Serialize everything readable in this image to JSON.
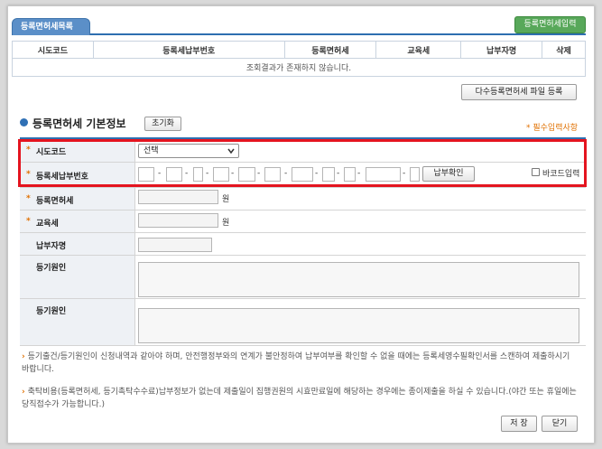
{
  "list_tab": {
    "label": "등록면허세목록"
  },
  "list_add_button": "등록면허세입력",
  "list_table": {
    "headers": [
      "시도코드",
      "등록세납부번호",
      "등록면허세",
      "교육세",
      "납부자명",
      "삭제"
    ],
    "empty_message": "조회결과가 존재하지 않습니다."
  },
  "bulk_register_button": "다수등록면허세 파일 등록",
  "basic_info": {
    "title": "등록면허세 기본정보",
    "reset_button": "초기화",
    "required_note": "* 필수입력사항"
  },
  "form": {
    "sido_label": "시도코드",
    "sido_selected": "선택",
    "payment_no_label": "등록세납부번호",
    "confirm_button": "납부확인",
    "barcode_label": "바코드입력",
    "reg_tax_label": "등록면허세",
    "edu_tax_label": "교육세",
    "payer_label": "납부자명",
    "reg_reason_label": "등기원인",
    "reg_cause_label": "등기원인"
  },
  "notes": [
    "등기출건/등기원인이 신청내역과 같아야 하며, 안전행정부와의 연계가 불안정하여 납부여부를 확인할 수 없을 때에는 등록세영수필확인서를 스캔하여 제출하시기 바랍니다.",
    "축탁비용(등록면허세, 등기촉탁수수료)납부정보가 없는데 제출일이 집행권원의 시효만료일에 해당하는 경우에는 종이제출을 하실 수 있습니다.(야간 또는 휴일에는 당직접수가 가능합니다.)"
  ],
  "footer": {
    "save": "저 장",
    "close": "닫기"
  },
  "units": {
    "won": "원"
  },
  "colors": {
    "highlight": "#e4141f",
    "accent": "#2e6fb0",
    "required": "#e07000",
    "add_button": "#58a85a"
  }
}
